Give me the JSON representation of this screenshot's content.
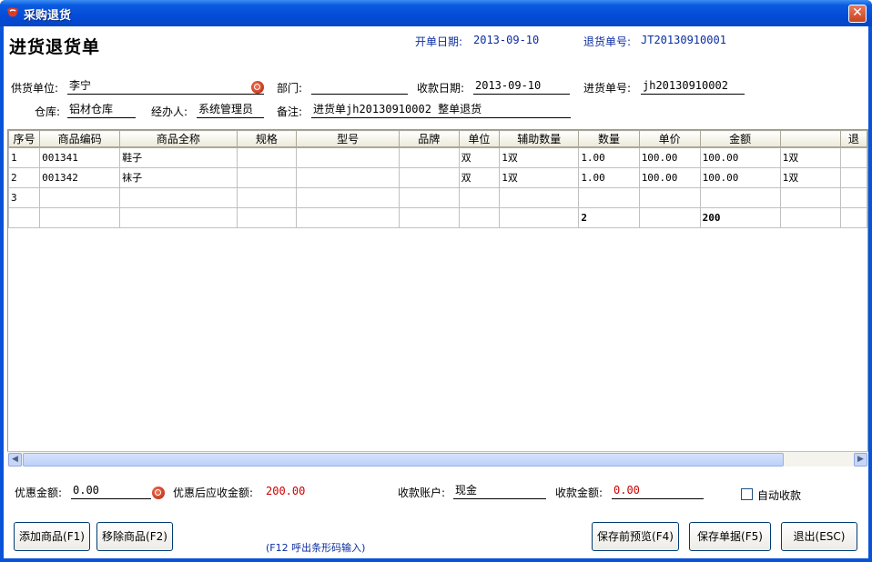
{
  "window": {
    "title": "采购退货"
  },
  "header": {
    "page_title": "进货退货单",
    "open_date_label": "开单日期:",
    "open_date_value": "2013-09-10",
    "return_no_label": "退货单号:",
    "return_no_value": "JT20130910001"
  },
  "form": {
    "supplier_label": "供货单位:",
    "supplier_value": "李宁",
    "dept_label": "部门:",
    "dept_value": "",
    "receive_date_label": "收款日期:",
    "receive_date_value": "2013-09-10",
    "purchase_no_label": "进货单号:",
    "purchase_no_value": "jh20130910002",
    "warehouse_label": "仓库:",
    "warehouse_value": "铝材仓库",
    "handler_label": "经办人:",
    "handler_value": "系统管理员",
    "note_label": "备注:",
    "note_value": "进货单jh20130910002 整单退货"
  },
  "grid": {
    "columns": [
      "序号",
      "商品编码",
      "商品全称",
      "规格",
      "型号",
      "品牌",
      "单位",
      "辅助数量",
      "数量",
      "单价",
      "金额",
      "",
      "退"
    ],
    "rows": [
      [
        "1",
        "001341",
        "鞋子",
        "",
        "",
        "",
        "双",
        "1双",
        "1.00",
        "100.00",
        "100.00",
        "1双",
        ""
      ],
      [
        "2",
        "001342",
        "袜子",
        "",
        "",
        "",
        "双",
        "1双",
        "1.00",
        "100.00",
        "100.00",
        "1双",
        ""
      ],
      [
        "3",
        "",
        "",
        "",
        "",
        "",
        "",
        "",
        "",
        "",
        "",
        "",
        ""
      ]
    ],
    "total": [
      "",
      "",
      "",
      "",
      "",
      "",
      "",
      "",
      "2",
      "",
      "200",
      "",
      ""
    ]
  },
  "footer": {
    "discount_label": "优惠金额:",
    "discount_value": "0.00",
    "after_discount_label": "优惠后应收金额:",
    "after_discount_value": "200.00",
    "account_label": "收款账户:",
    "account_value": "现金",
    "receive_amount_label": "收款金额:",
    "receive_amount_value": "0.00",
    "auto_receive_label": "自动收款"
  },
  "buttons": {
    "add": "添加商品(F1)",
    "remove": "移除商品(F2)",
    "barcode_hint": "(F12 呼出条形码输入)",
    "preview": "保存前预览(F4)",
    "save": "保存单据(F5)",
    "exit": "退出(ESC)"
  },
  "colors": {
    "title_blue": "#0b2da0",
    "amount_red": "#cc0000",
    "titlebar": "#0a53d8"
  }
}
